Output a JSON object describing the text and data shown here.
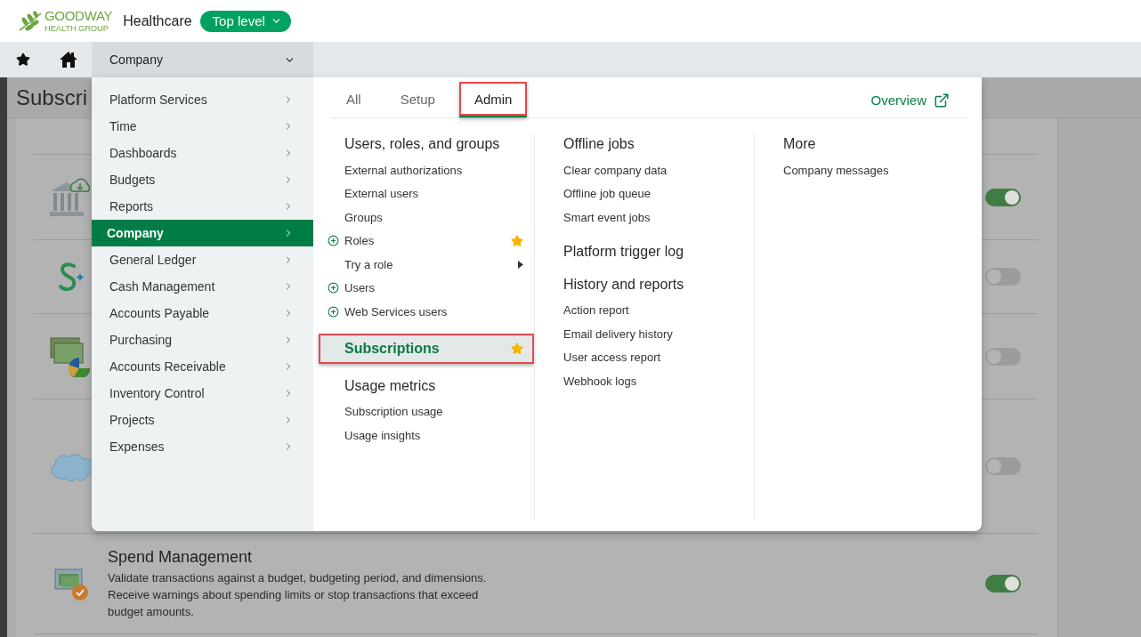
{
  "header": {
    "logo_name": "GOODWAY",
    "logo_tagline": "HEALTH GROUP",
    "company": "Healthcare",
    "level_button": "Top level"
  },
  "nav": {
    "module_menu": "Company"
  },
  "page": {
    "title": "Subscri",
    "rows": [
      {
        "kind": "bank",
        "on": true
      },
      {
        "kind": "app",
        "on": false
      },
      {
        "kind": "finance",
        "on": false
      },
      {
        "kind": "cloud",
        "on": false
      },
      {
        "kind": "spend",
        "on": true,
        "title": "Spend Management",
        "description": "Validate transactions against a budget, budgeting period, and dimensions. Receive warnings about spending limits or stop transactions that exceed budget amounts."
      }
    ]
  },
  "mega_menu": {
    "categories": [
      {
        "label": "Platform Services",
        "selected": false
      },
      {
        "label": "Time",
        "selected": false
      },
      {
        "label": "Dashboards",
        "selected": false
      },
      {
        "label": "Budgets",
        "selected": false
      },
      {
        "label": "Reports",
        "selected": false
      },
      {
        "label": "Company",
        "selected": true
      },
      {
        "label": "General Ledger",
        "selected": false
      },
      {
        "label": "Cash Management",
        "selected": false
      },
      {
        "label": "Accounts Payable",
        "selected": false
      },
      {
        "label": "Purchasing",
        "selected": false
      },
      {
        "label": "Accounts Receivable",
        "selected": false
      },
      {
        "label": "Inventory Control",
        "selected": false
      },
      {
        "label": "Projects",
        "selected": false
      },
      {
        "label": "Expenses",
        "selected": false
      }
    ],
    "tabs": [
      {
        "label": "All",
        "selected": false,
        "annotated": false
      },
      {
        "label": "Setup",
        "selected": false,
        "annotated": false
      },
      {
        "label": "Admin",
        "selected": true,
        "annotated": true
      }
    ],
    "overview_link": "Overview",
    "columns": [
      {
        "sections": [
          {
            "heading": "Users, roles, and groups",
            "selected": false,
            "favorite": false,
            "annotated": false,
            "items": [
              {
                "label": "External authorizations",
                "add": false,
                "favorite": false,
                "submenu": false
              },
              {
                "label": "External users",
                "add": false,
                "favorite": false,
                "submenu": false
              },
              {
                "label": "Groups",
                "add": false,
                "favorite": false,
                "submenu": false
              },
              {
                "label": "Roles",
                "add": true,
                "favorite": true,
                "submenu": false
              },
              {
                "label": "Try a role",
                "add": false,
                "favorite": false,
                "submenu": true
              },
              {
                "label": "Users",
                "add": true,
                "favorite": false,
                "submenu": false
              },
              {
                "label": "Web Services users",
                "add": true,
                "favorite": false,
                "submenu": false
              }
            ]
          },
          {
            "heading": "Subscriptions",
            "selected": true,
            "favorite": true,
            "annotated": true
          },
          {
            "heading": "Usage metrics",
            "selected": false,
            "favorite": false,
            "annotated": false,
            "items": [
              {
                "label": "Subscription usage",
                "add": false,
                "favorite": false,
                "submenu": false
              },
              {
                "label": "Usage insights",
                "add": false,
                "favorite": false,
                "submenu": false
              }
            ]
          }
        ]
      },
      {
        "sections": [
          {
            "heading": "Offline jobs",
            "selected": false,
            "items": [
              {
                "label": "Clear company data"
              },
              {
                "label": "Offline job queue"
              },
              {
                "label": "Smart event jobs"
              }
            ]
          },
          {
            "heading": "Platform trigger log",
            "selected": false
          },
          {
            "heading": "History and reports",
            "selected": false,
            "items": [
              {
                "label": "Action report"
              },
              {
                "label": "Email delivery history"
              },
              {
                "label": "User access report"
              },
              {
                "label": "Webhook logs"
              }
            ]
          }
        ]
      },
      {
        "sections": [
          {
            "heading": "More",
            "selected": false,
            "items": [
              {
                "label": "Company messages"
              }
            ]
          }
        ]
      }
    ]
  }
}
